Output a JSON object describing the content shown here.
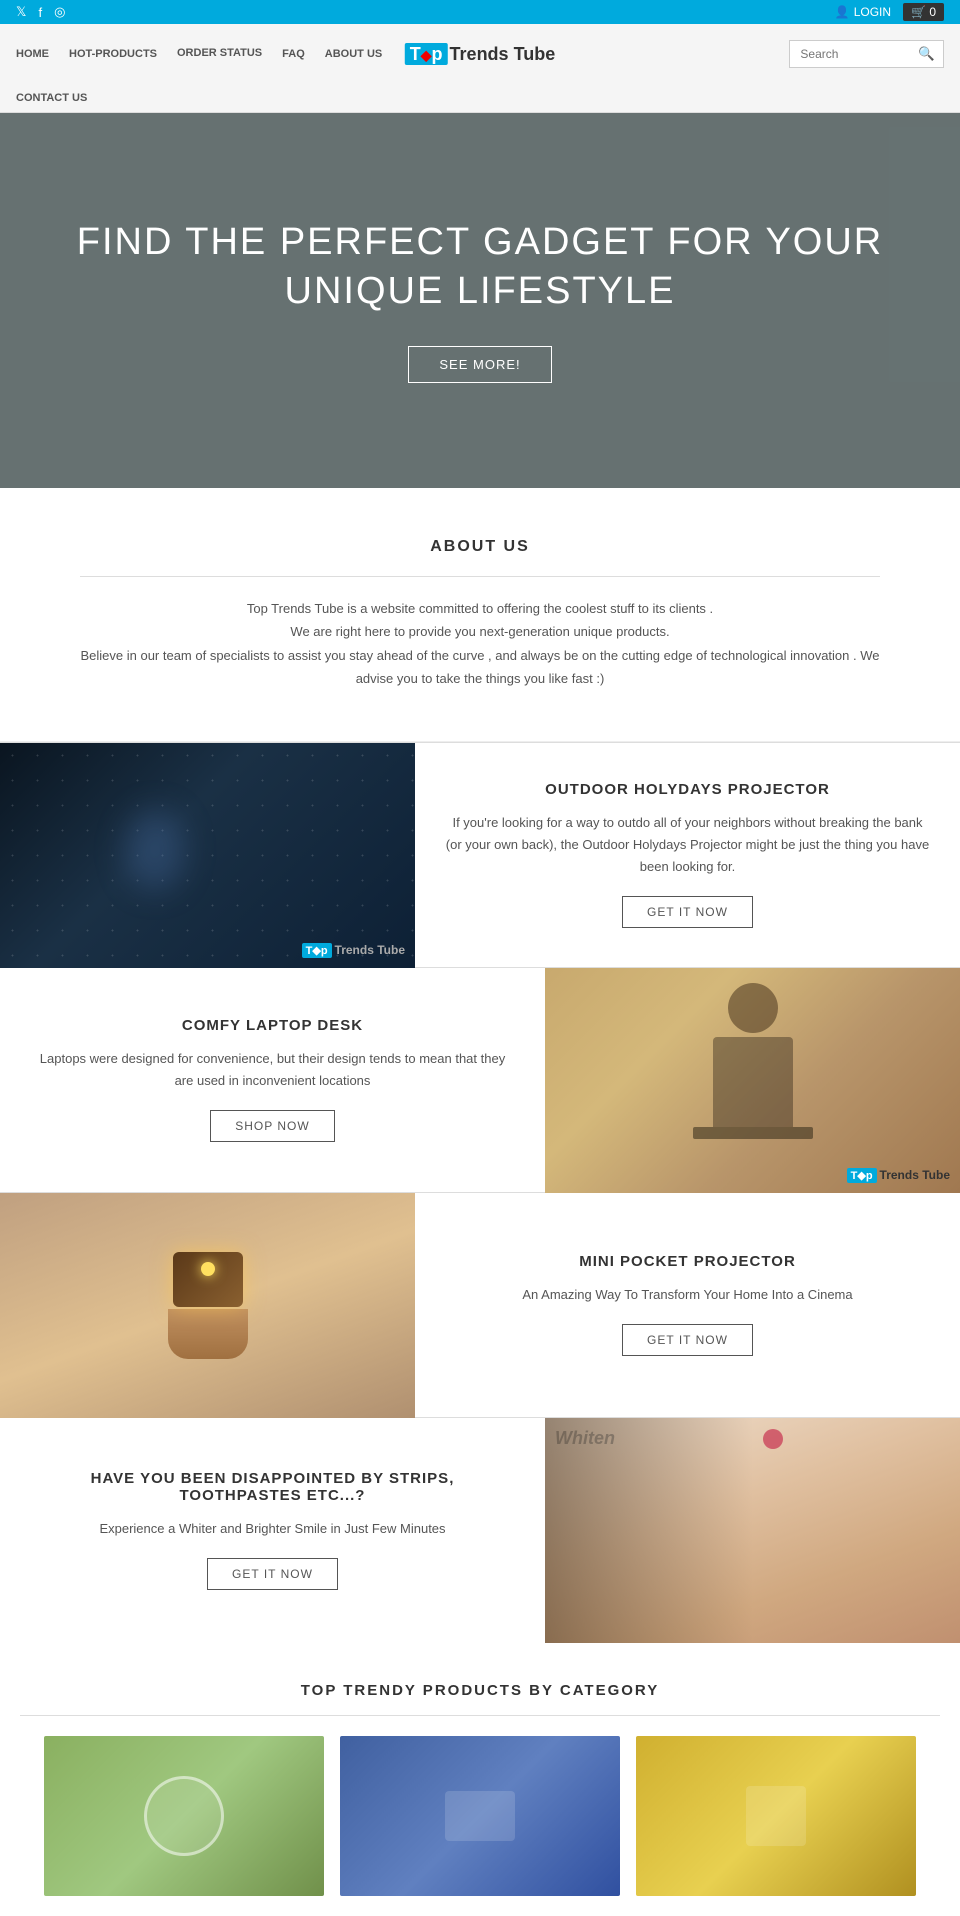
{
  "topbar": {
    "social": [
      "twitter",
      "facebook",
      "instagram"
    ],
    "login_label": "LOGIN",
    "cart_label": "0"
  },
  "nav": {
    "links": [
      "HOME",
      "HOT-PRODUCTS",
      "ORDER STATUS",
      "FAQ",
      "ABOUT US"
    ],
    "logo_highlight": "T",
    "logo_name": "op",
    "logo_tagline": "Trends Tube",
    "search_placeholder": "Search",
    "contact_label": "CONTACT US"
  },
  "hero": {
    "headline": "FIND THE PERFECT GADGET FOR YOUR UNIQUE LIFESTYLE",
    "cta_label": "SEE MORE!"
  },
  "about": {
    "section_title": "ABOUT US",
    "paragraph1": "Top Trends Tube is a website committed to offering the coolest stuff to its clients .",
    "paragraph2": "We are right here to provide you next-generation unique products.",
    "paragraph3": "Believe in our team of specialists to assist you stay ahead of the curve , and always be on the cutting edge of technological innovation . We advise you to take the things you like fast :)"
  },
  "products": [
    {
      "id": "outdoor-projector",
      "title": "OUTDOOR HOLYDAYS PROJECTOR",
      "description": "If you're looking for a way to outdo all of your neighbors without breaking the bank (or your own back), the Outdoor Holydays Projector might be just the thing you have been looking for.",
      "cta_label": "GET IT NOW",
      "image_side": "left",
      "image_type": "dark"
    },
    {
      "id": "comfy-laptop-desk",
      "title": "COMFY LAPTOP DESK",
      "description": "Laptops were designed for convenience, but their design tends to mean that they are used in inconvenient locations",
      "cta_label": "SHOP NOW",
      "image_side": "right",
      "image_type": "laptop"
    },
    {
      "id": "mini-pocket-projector",
      "title": "MINI POCKET PROJECTOR",
      "description": "An Amazing Way To Transform Your Home Into a Cinema",
      "cta_label": "GET IT NOW",
      "image_side": "left",
      "image_type": "hand"
    },
    {
      "id": "teeth-whitening",
      "title": "HAVE YOU BEEN DISAPPOINTED BY STRIPS, TOOTHPASTES ETC...?",
      "description": "Experience a Whiter and Brighter Smile in Just Few Minutes",
      "cta_label": "GET IT NOW",
      "image_side": "right",
      "image_type": "woman"
    }
  ],
  "categories": {
    "section_title": "TOP TRENDY PRODUCTS BY CATEGORY",
    "items": [
      {
        "id": "cat1",
        "color": "green"
      },
      {
        "id": "cat2",
        "color": "blue"
      },
      {
        "id": "cat3",
        "color": "yellow"
      }
    ]
  }
}
